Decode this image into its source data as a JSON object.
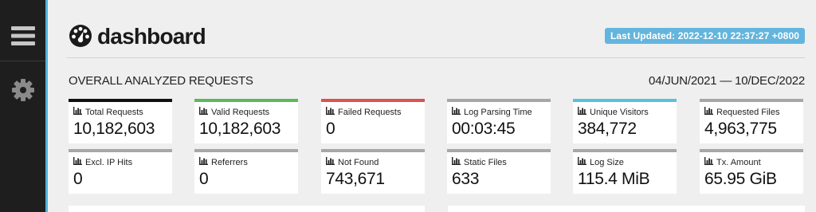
{
  "app": {
    "title": "dashboard",
    "last_updated": "Last Updated: 2022-12-10 22:37:27 +0800"
  },
  "sidebar": {
    "items": [
      {
        "icon": "hamburger-menu-icon"
      },
      {
        "icon": "gear-icon"
      }
    ]
  },
  "overview": {
    "title": "OVERALL ANALYZED REQUESTS",
    "date_range": "04/JUN/2021 — 10/DEC/2022",
    "cards": [
      {
        "label": "Total Requests",
        "value": "10,182,603",
        "accent": "#111111"
      },
      {
        "label": "Valid Requests",
        "value": "10,182,603",
        "accent": "#5cb85c"
      },
      {
        "label": "Failed Requests",
        "value": "0",
        "accent": "#d9534f"
      },
      {
        "label": "Log Parsing Time",
        "value": "00:03:45",
        "accent": "#a7a7a7"
      },
      {
        "label": "Unique Visitors",
        "value": "384,772",
        "accent": "#5bc0de"
      },
      {
        "label": "Requested Files",
        "value": "4,963,775",
        "accent": "#a7a7a7"
      },
      {
        "label": "Excl. IP Hits",
        "value": "0",
        "accent": "#a7a7a7"
      },
      {
        "label": "Referrers",
        "value": "0",
        "accent": "#a7a7a7"
      },
      {
        "label": "Not Found",
        "value": "743,671",
        "accent": "#a7a7a7"
      },
      {
        "label": "Static Files",
        "value": "633",
        "accent": "#a7a7a7"
      },
      {
        "label": "Log Size",
        "value": "115.4 MiB",
        "accent": "#a7a7a7"
      },
      {
        "label": "Tx. Amount",
        "value": "65.95 GiB",
        "accent": "#a7a7a7"
      }
    ]
  },
  "colors": {
    "sidebar": "#1e1e1e",
    "accent_blue": "#5bc0de",
    "badge": "#63b5dd"
  }
}
